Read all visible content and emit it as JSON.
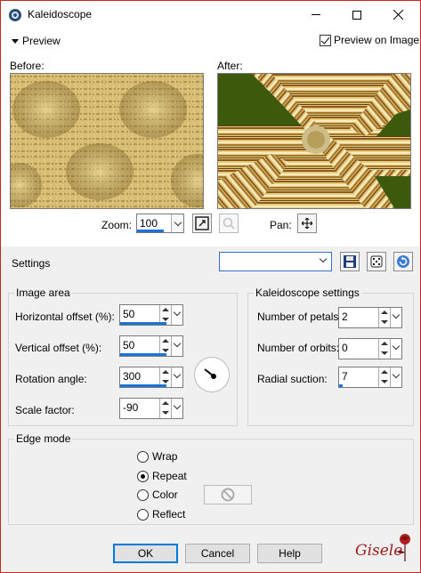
{
  "window": {
    "title": "Kaleidoscope"
  },
  "preview": {
    "toggle_label": "Preview",
    "preview_on_image_label": "Preview on Image",
    "preview_on_image_checked": true,
    "before_label": "Before:",
    "after_label": "After:",
    "zoom_label": "Zoom:",
    "zoom_value": "100",
    "pan_label": "Pan:"
  },
  "settings": {
    "label": "Settings",
    "preset_value": ""
  },
  "image_area": {
    "title": "Image area",
    "horizontal_offset_label": "Horizontal offset (%):",
    "horizontal_offset_value": "50",
    "vertical_offset_label": "Vertical offset (%):",
    "vertical_offset_value": "50",
    "rotation_angle_label": "Rotation angle:",
    "rotation_angle_value": "300",
    "scale_factor_label": "Scale factor:",
    "scale_factor_value": "-90"
  },
  "kaleidoscope": {
    "title": "Kaleidoscope settings",
    "petals_label": "Number of petals:",
    "petals_value": "2",
    "orbits_label": "Number of orbits:",
    "orbits_value": "0",
    "suction_label": "Radial suction:",
    "suction_value": "7"
  },
  "edge_mode": {
    "title": "Edge mode",
    "options": [
      "Wrap",
      "Repeat",
      "Color",
      "Reflect"
    ],
    "selected": "Repeat"
  },
  "buttons": {
    "ok": "OK",
    "cancel": "Cancel",
    "help": "Help"
  },
  "watermark": {
    "text": "Gisele"
  },
  "colors": {
    "accent": "#1e74d6",
    "close_border": "#c42b1c",
    "field_green": "#3d5a0c"
  }
}
